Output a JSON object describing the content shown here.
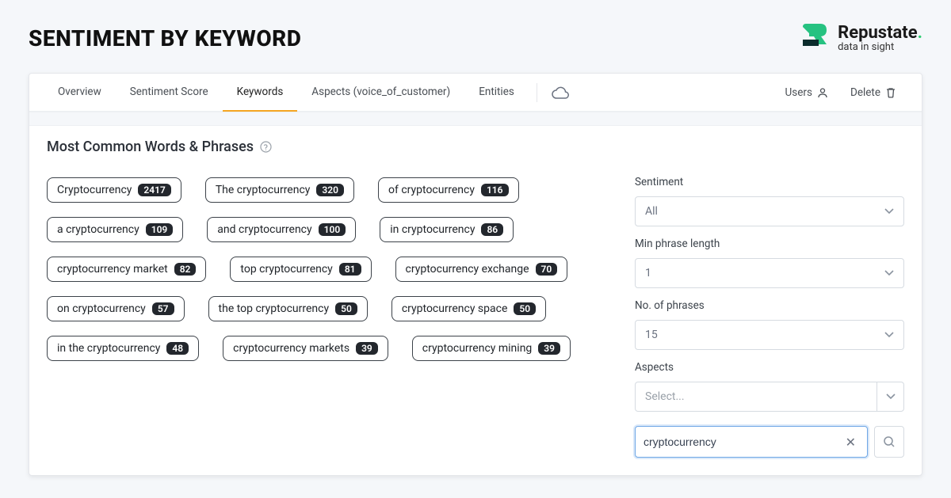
{
  "page_title": "SENTIMENT BY KEYWORD",
  "brand": {
    "name": "Repustate",
    "tagline": "data in sight"
  },
  "tabs": [
    {
      "label": "Overview",
      "active": false
    },
    {
      "label": "Sentiment Score",
      "active": false
    },
    {
      "label": "Keywords",
      "active": true
    },
    {
      "label": "Aspects (voice_of_customer)",
      "active": false
    },
    {
      "label": "Entities",
      "active": false
    }
  ],
  "actions": {
    "users": "Users",
    "delete": "Delete"
  },
  "section_title": "Most Common Words & Phrases",
  "pills": [
    {
      "label": "Cryptocurrency",
      "count": "2417"
    },
    {
      "label": "The cryptocurrency",
      "count": "320"
    },
    {
      "label": "of cryptocurrency",
      "count": "116"
    },
    {
      "label": "a cryptocurrency",
      "count": "109"
    },
    {
      "label": "and cryptocurrency",
      "count": "100"
    },
    {
      "label": "in cryptocurrency",
      "count": "86"
    },
    {
      "label": "cryptocurrency market",
      "count": "82"
    },
    {
      "label": "top cryptocurrency",
      "count": "81"
    },
    {
      "label": "cryptocurrency exchange",
      "count": "70"
    },
    {
      "label": "on cryptocurrency",
      "count": "57"
    },
    {
      "label": "the top cryptocurrency",
      "count": "50"
    },
    {
      "label": "cryptocurrency space",
      "count": "50"
    },
    {
      "label": "in the cryptocurrency",
      "count": "48"
    },
    {
      "label": "cryptocurrency markets",
      "count": "39"
    },
    {
      "label": "cryptocurrency mining",
      "count": "39"
    }
  ],
  "filters": {
    "sentiment_label": "Sentiment",
    "sentiment_value": "All",
    "min_phrase_label": "Min phrase length",
    "min_phrase_value": "1",
    "num_phrases_label": "No. of phrases",
    "num_phrases_value": "15",
    "aspects_label": "Aspects",
    "aspects_placeholder": "Select...",
    "search_value": "cryptocurrency"
  }
}
